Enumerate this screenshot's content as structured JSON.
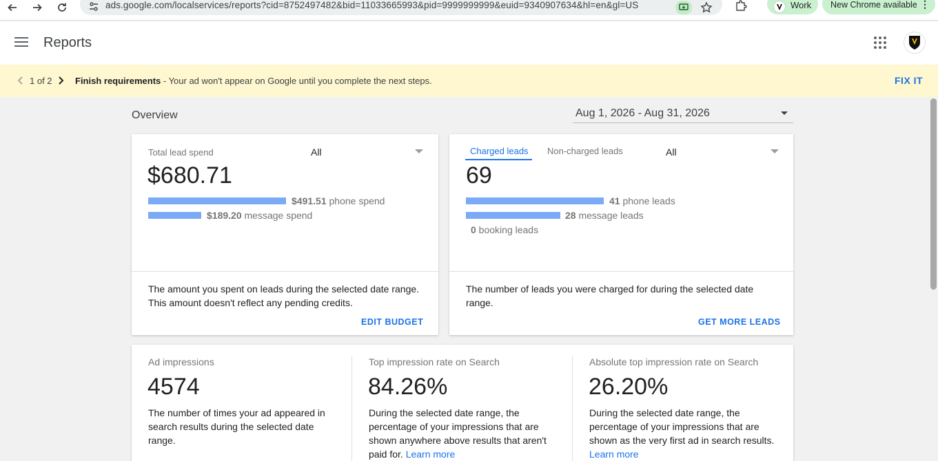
{
  "browser": {
    "url": "ads.google.com/localservices/reports?cid=8752497482&bid=11033665993&pid=9999999999&euid=9340907634&hl=en&gl=US",
    "profile_label": "Work",
    "update_label": "New Chrome available"
  },
  "header": {
    "title": "Reports"
  },
  "banner": {
    "pager": "1 of 2",
    "title": "Finish requirements",
    "message": " - Your ad won't appear on Google until you complete the next steps.",
    "action": "FIX IT"
  },
  "overview": {
    "title": "Overview",
    "date_range": "Aug 1, 2026 - Aug 31, 2026"
  },
  "spend_card": {
    "label": "Total lead spend",
    "filter": "All",
    "total": "$680.71",
    "rows": [
      {
        "amount": "$491.51",
        "text": " phone spend",
        "fraction": 0.722
      },
      {
        "amount": "$189.20",
        "text": " message spend",
        "fraction": 0.278
      }
    ],
    "description": "The amount you spent on leads during the selected date range. This amount doesn't reflect any pending credits.",
    "action": "EDIT BUDGET"
  },
  "leads_card": {
    "tab_active": "Charged leads",
    "tab_inactive": "Non-charged leads",
    "filter": "All",
    "total": "69",
    "rows": [
      {
        "amount": "41",
        "text": " phone leads",
        "fraction": 0.594
      },
      {
        "amount": "28",
        "text": " message leads",
        "fraction": 0.406
      },
      {
        "amount": "0",
        "text": " booking leads",
        "fraction": 0
      }
    ],
    "description": "The number of leads you were charged for during the selected date range.",
    "action": "GET MORE LEADS"
  },
  "impressions": [
    {
      "label": "Ad impressions",
      "value": "4574",
      "description": "The number of times your ad appeared in search results during the selected date range.",
      "link": ""
    },
    {
      "label": "Top impression rate on Search",
      "value": "84.26%",
      "description": "During the selected date range, the percentage of your impressions that are shown anywhere above results that aren't paid for. ",
      "link": "Learn more"
    },
    {
      "label": "Absolute top impression rate on Search",
      "value": "26.20%",
      "description": "During the selected date range, the percentage of your impressions that are shown as the very first ad in search results. ",
      "link": "Learn more"
    }
  ],
  "colors": {
    "accent": "#1a73e8",
    "bar": "#7baaf7",
    "banner": "#fef7cf"
  }
}
